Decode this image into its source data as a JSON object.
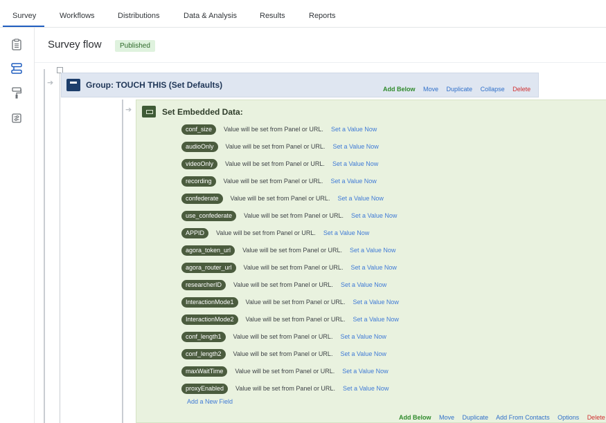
{
  "nav": {
    "tabs": [
      {
        "label": "Survey",
        "active": true
      },
      {
        "label": "Workflows"
      },
      {
        "label": "Distributions"
      },
      {
        "label": "Data & Analysis"
      },
      {
        "label": "Results"
      },
      {
        "label": "Reports"
      }
    ]
  },
  "rail": {
    "icons": [
      "clipboard-icon",
      "survey-flow-icon",
      "paint-roller-icon",
      "tools-icon"
    ]
  },
  "header": {
    "title": "Survey flow",
    "status": "Published"
  },
  "group": {
    "title": "Group: TOUCH THIS (Set Defaults)",
    "actions": {
      "add_below": "Add Below",
      "move": "Move",
      "duplicate": "Duplicate",
      "collapse": "Collapse",
      "delete": "Delete"
    }
  },
  "embedded": {
    "title": "Set Embedded Data:",
    "fields": [
      {
        "name": "conf_size",
        "text": "Value will be set from Panel or URL.",
        "link": "Set a Value Now"
      },
      {
        "name": "audioOnly",
        "text": "Value will be set from Panel or URL.",
        "link": "Set a Value Now"
      },
      {
        "name": "videoOnly",
        "text": "Value will be set from Panel or URL.",
        "link": "Set a Value Now"
      },
      {
        "name": "recording",
        "text": "Value will be set from Panel or URL.",
        "link": "Set a Value Now"
      },
      {
        "name": "confederate",
        "text": "Value will be set from Panel or URL.",
        "link": "Set a Value Now"
      },
      {
        "name": "use_confederate",
        "text": "Value will be set from Panel or URL.",
        "link": "Set a Value Now"
      },
      {
        "name": "APPID",
        "text": "Value will be set from Panel or URL.",
        "link": "Set a Value Now"
      },
      {
        "name": "agora_token_url",
        "text": "Value will be set from Panel or URL.",
        "link": "Set a Value Now"
      },
      {
        "name": "agora_router_url",
        "text": "Value will be set from Panel or URL.",
        "link": "Set a Value Now"
      },
      {
        "name": "researcherID",
        "text": "Value will be set from Panel or URL.",
        "link": "Set a Value Now"
      },
      {
        "name": "InteractionMode1",
        "text": "Value will be set from Panel or URL.",
        "link": "Set a Value Now"
      },
      {
        "name": "InteractionMode2",
        "text": "Value will be set from Panel or URL.",
        "link": "Set a Value Now"
      },
      {
        "name": "conf_length1",
        "text": "Value will be set from Panel or URL.",
        "link": "Set a Value Now"
      },
      {
        "name": "conf_length2",
        "text": "Value will be set from Panel or URL.",
        "link": "Set a Value Now"
      },
      {
        "name": "maxWaitTime",
        "text": "Value will be set from Panel or URL.",
        "link": "Set a Value Now"
      },
      {
        "name": "proxyEnabled",
        "text": "Value will be set from Panel or URL.",
        "link": "Set a Value Now"
      }
    ],
    "add_field": "Add a New Field",
    "actions": {
      "add_below": "Add Below",
      "move": "Move",
      "duplicate": "Duplicate",
      "add_from_contacts": "Add From Contacts",
      "options": "Options",
      "delete": "Delete"
    }
  },
  "colors": {
    "accent": "#1f5dbf",
    "group_bg": "#dfe6f1",
    "embedded_bg": "#e9f2df",
    "pill": "#4b5c3e",
    "link": "#3f7ad6",
    "delete": "#d02f2f",
    "published_bg": "#dff2de"
  }
}
